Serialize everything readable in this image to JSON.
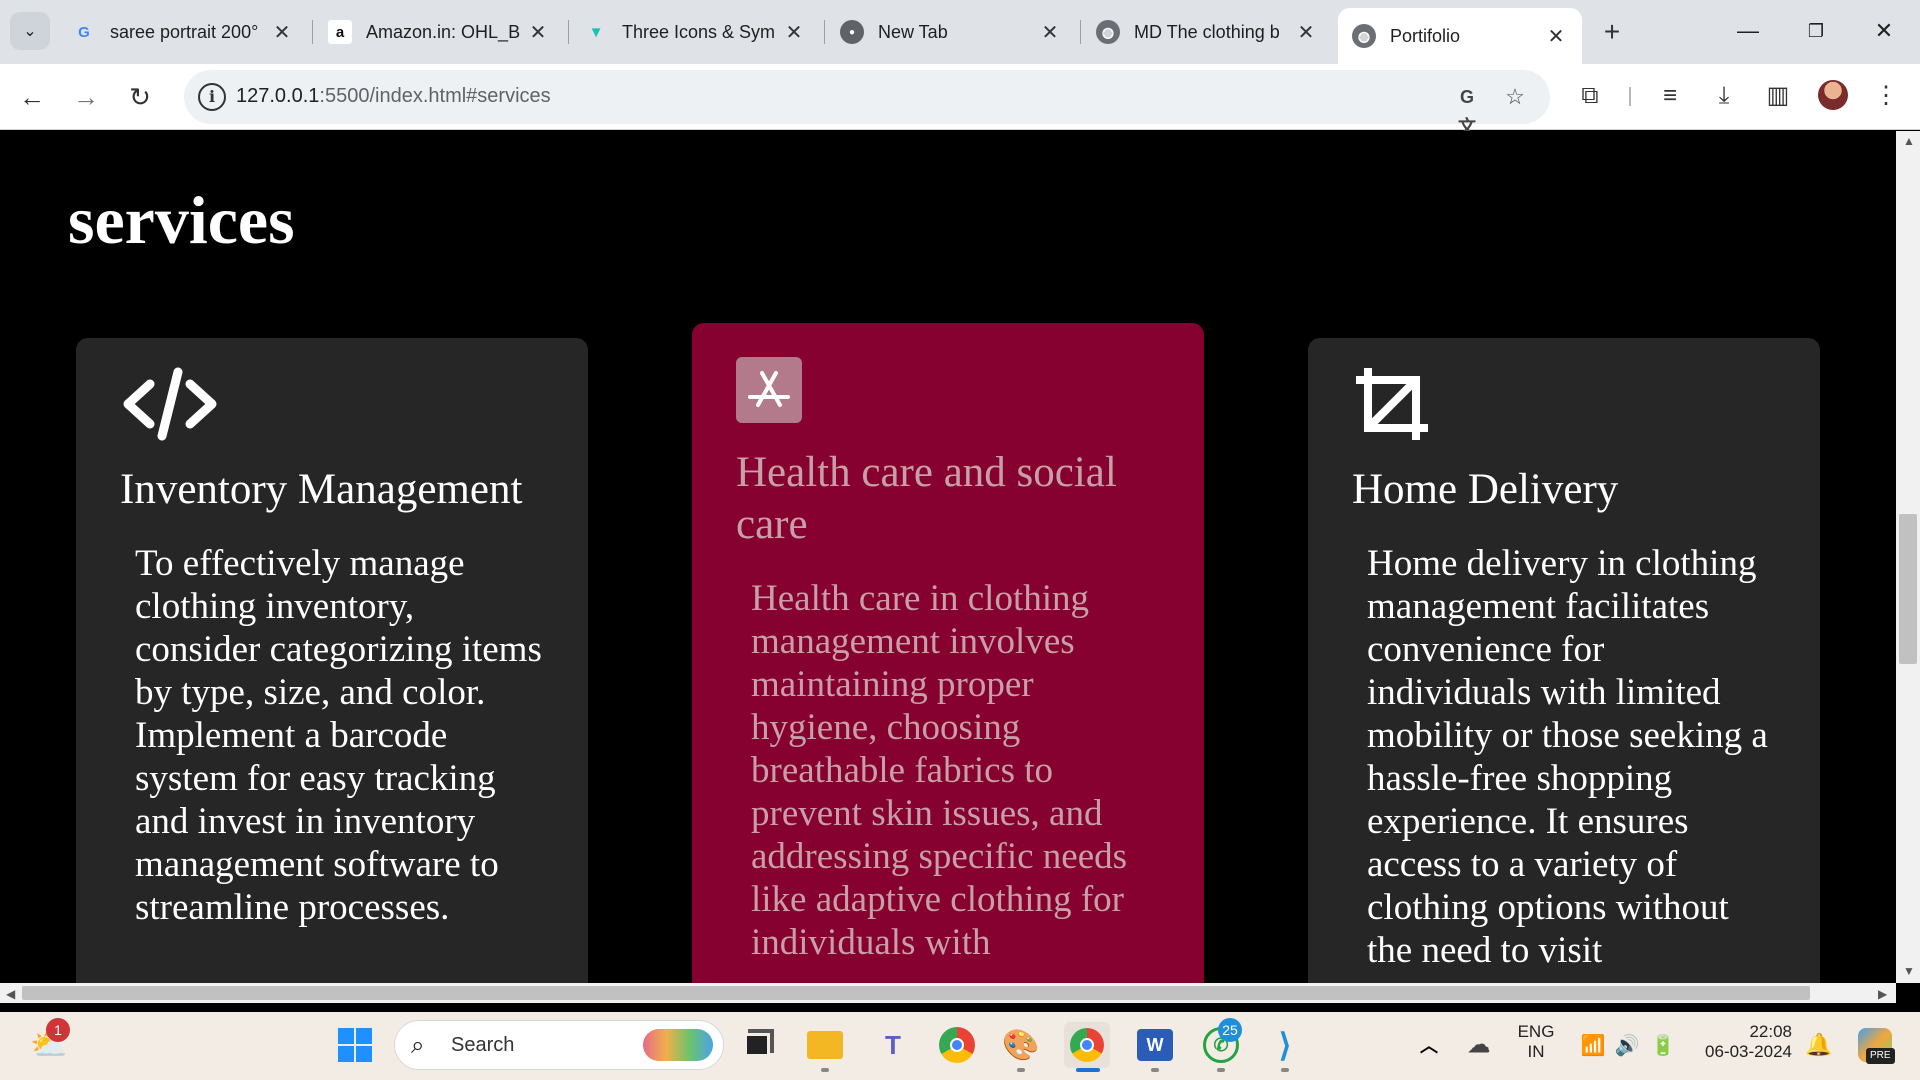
{
  "browser": {
    "tabs": [
      {
        "title": "saree portrait 200°",
        "favicon": "google-g-icon",
        "active": false
      },
      {
        "title": "Amazon.in: OHL_B",
        "favicon": "amazon-icon",
        "active": false
      },
      {
        "title": "Three Icons & Sym",
        "favicon": "vercel-v-icon",
        "active": false
      },
      {
        "title": "New Tab",
        "favicon": "chrome-icon",
        "active": false
      },
      {
        "title": "MD The clothing b",
        "favicon": "globe-icon",
        "active": false
      },
      {
        "title": "Portifolio",
        "favicon": "globe-icon",
        "active": true
      }
    ],
    "url_host": "127.0.0.1",
    "url_rest": ":5500/index.html#services"
  },
  "page": {
    "section_title": "services",
    "cards": [
      {
        "icon": "code-icon",
        "heading": "Inventory Management",
        "description": "To effectively manage clothing inventory, consider categorizing items by type, size, and color. Implement a barcode system for easy tracking and invest in inventory management software to streamline processes."
      },
      {
        "icon": "app-store-icon",
        "heading": "Health care and social care",
        "description": "Health care in clothing management involves maintaining proper hygiene, choosing breathable fabrics to prevent skin issues, and addressing specific needs like adaptive clothing for individuals with"
      },
      {
        "icon": "crop-icon",
        "heading": "Home Delivery",
        "description": "Home delivery in clothing management facilitates convenience for individuals with limited mobility or those seeking a hassle-free shopping experience. It ensures access to a variety of clothing options without the need to visit"
      }
    ],
    "colors": {
      "background": "#000000",
      "card": "#262626",
      "card_highlight": "#870130"
    }
  },
  "taskbar": {
    "search_label": "Search",
    "weather_badge": "1",
    "whatsapp_badge": "25",
    "lang_line1": "ENG",
    "lang_line2": "IN",
    "time": "22:08",
    "date": "06-03-2024",
    "copilot_badge": "PRE"
  }
}
